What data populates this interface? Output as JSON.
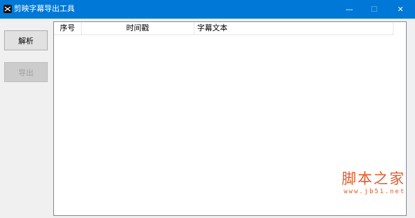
{
  "window": {
    "title": "剪映字幕导出工具",
    "icon": "capcut-logo-icon",
    "controls": {
      "minimize": "—",
      "maximize": "☐",
      "close": "✕"
    }
  },
  "buttons": {
    "parse_label": "解析",
    "export_label": "导出",
    "export_enabled": false
  },
  "table": {
    "columns": [
      "序号",
      "时间戳",
      "字幕文本"
    ],
    "rows": []
  },
  "watermark": {
    "brand": "脚本之家",
    "url": "www.jb51.net",
    "color": "#e25a2a"
  },
  "colors": {
    "titlebar": "#0078d7",
    "window_bg": "#f0f0f0"
  }
}
